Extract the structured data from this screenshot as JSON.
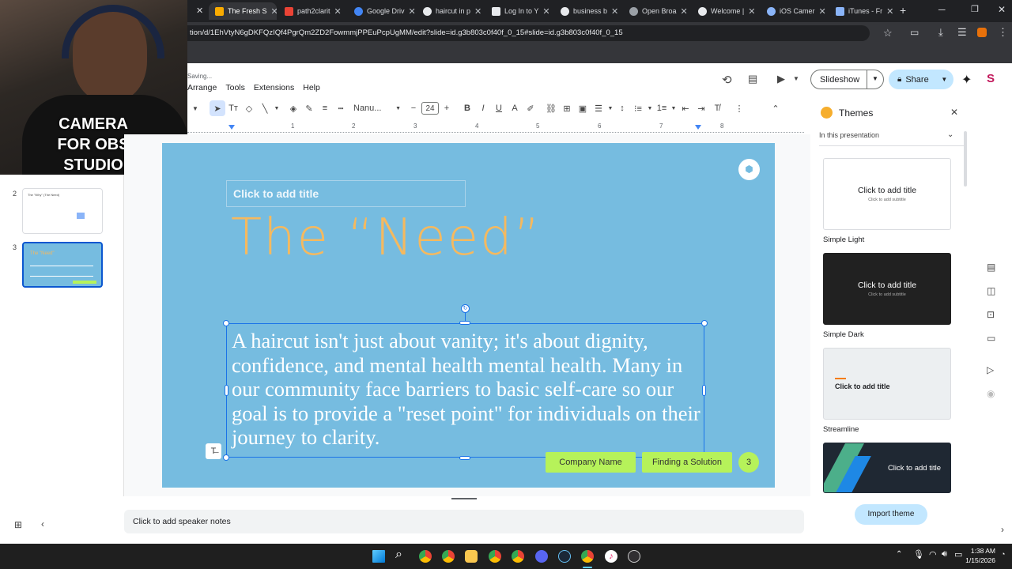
{
  "browser": {
    "tabs": [
      {
        "label": "The Fresh S",
        "active": true,
        "color": "#f9ab00"
      },
      {
        "label": "path2clarit",
        "color": "#ea4335"
      },
      {
        "label": "Google Driv",
        "color": "#4285f4"
      },
      {
        "label": "haircut in p",
        "color": "#e8eaed"
      },
      {
        "label": "Log In to Y",
        "color": "#e8eaed"
      },
      {
        "label": "business b",
        "color": "#e8eaed"
      },
      {
        "label": "Open Broa",
        "color": "#9aa0a6"
      },
      {
        "label": "Welcome |",
        "color": "#e8eaed"
      },
      {
        "label": "iOS Camer",
        "color": "#8ab4f8"
      },
      {
        "label": "iTunes - Fr",
        "color": "#8ab4f8"
      }
    ],
    "url": "tion/d/1EhVtyN6gDKFQzIQf4PgrQm2ZD2FowmmjPPEuPcpUgMM/edit?slide=id.g3b803c0f40f_0_15#slide=id.g3b803c0f40f_0_15"
  },
  "webcam": {
    "overlay_text": "CAMERA\nFOR OBS\nSTUDIO"
  },
  "docs": {
    "status": "Saving...",
    "menu": [
      "Arrange",
      "Tools",
      "Extensions",
      "Help"
    ],
    "slideshow_label": "Slideshow",
    "share_label": "Share"
  },
  "toolbar": {
    "font": "Nanu...",
    "font_size": "24"
  },
  "ruler": {
    "ticks": [
      "1",
      "2",
      "3",
      "4",
      "5",
      "6",
      "7",
      "8"
    ]
  },
  "filmstrip": {
    "slides": [
      {
        "number": "2",
        "title": "The \"Why\" (The Need)"
      },
      {
        "number": "3",
        "title": "The \"Need\"",
        "active": true
      }
    ]
  },
  "slide": {
    "placeholder_title": "Click to add title",
    "heading": "The “Need”",
    "body": "A haircut isn't just about vanity; it's about dignity, confidence, and mental health mental health. Many in our community face barriers to basic self-care so our goal is to provide a \"reset point\" for individuals on their journey to clarity.",
    "footer_company": "Company Name",
    "footer_section": "Finding a Solution",
    "page_number": "3",
    "colors": {
      "background": "#76bce0",
      "heading": "#f5b95f",
      "footer": "#b6f25a"
    }
  },
  "themes_panel": {
    "title": "Themes",
    "section": "In this presentation",
    "cards": [
      {
        "name": "Simple Light",
        "title": "Click to add title",
        "subtitle": "Click to add subtitle"
      },
      {
        "name": "Simple Dark",
        "title": "Click to add title",
        "subtitle": "Click to add subtitle"
      },
      {
        "name": "Streamline",
        "title": "Click to add title"
      },
      {
        "name": "",
        "title": "Click to add title"
      }
    ],
    "import_label": "Import theme"
  },
  "notes": {
    "placeholder": "Click to add speaker notes"
  },
  "taskbar": {
    "time": "1:38 AM",
    "date": "1/15/2026"
  }
}
